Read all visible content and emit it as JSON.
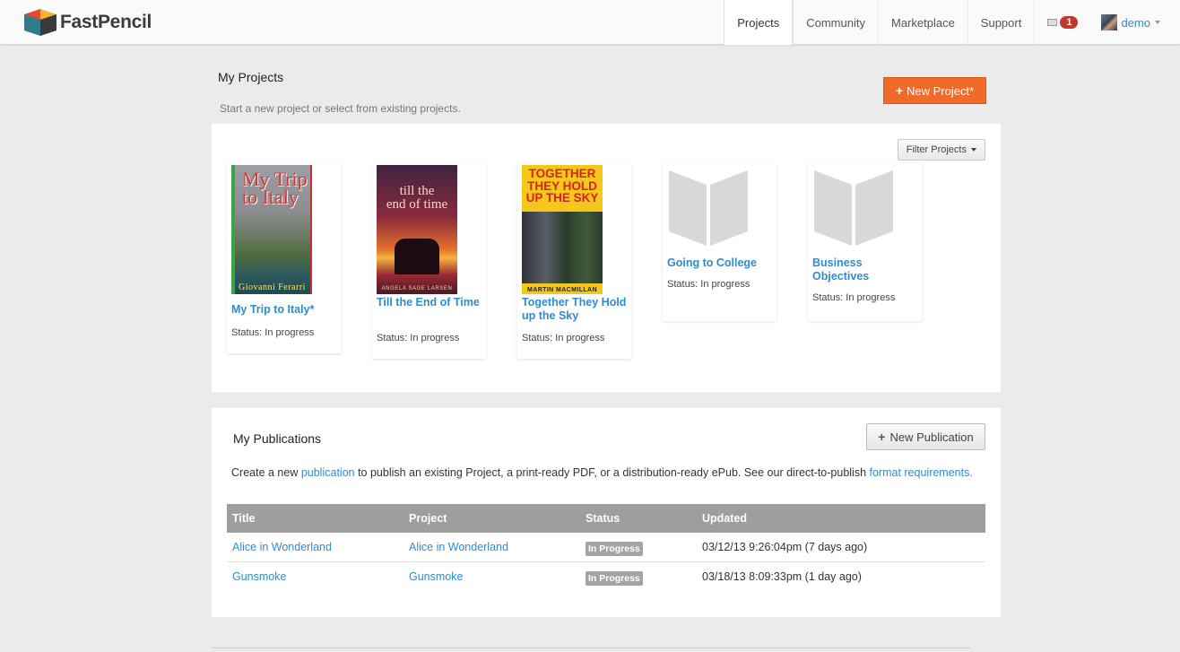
{
  "brand": {
    "name": "FastPencil",
    "logo_icon": "fastpencil-logo-icon"
  },
  "nav": {
    "items": [
      {
        "label": "Projects",
        "active": true
      },
      {
        "label": "Community",
        "active": false
      },
      {
        "label": "Marketplace",
        "active": false
      },
      {
        "label": "Support",
        "active": false
      }
    ],
    "mail_count": "1",
    "user_name": "demo"
  },
  "projects": {
    "title": "My Projects",
    "subtitle": "Start a new project or select from existing projects.",
    "new_project_label": "New Project*",
    "filter_label": "Filter Projects",
    "cards": [
      {
        "title": "My Trip to Italy*",
        "status": "Status: In progress",
        "cover": {
          "line1": "My Trip",
          "line2": "to Italy",
          "author": "Giovanni Ferarri"
        }
      },
      {
        "title": "Till the End of Time",
        "status": "Status: In progress",
        "cover": {
          "line1": "till the",
          "line2": "end of time",
          "author": "ANGELA SAGE LARSEN"
        }
      },
      {
        "title": "Together They Hold up the Sky",
        "status": "Status: In progress",
        "cover": {
          "line1": "TOGETHER",
          "line2": "THEY HOLD",
          "line3": "UP THE SKY",
          "author": "MARTIN MACMILLAN"
        }
      },
      {
        "title": "Going to College",
        "status": "Status: In progress",
        "cover": {
          "icon": "book-placeholder-icon"
        }
      },
      {
        "title": "Business Objectives",
        "status": "Status: In progress",
        "cover": {
          "icon": "book-placeholder-icon"
        }
      }
    ]
  },
  "publications": {
    "title": "My Publications",
    "new_pub_label": "New Publication",
    "desc_pre": "Create a new ",
    "desc_link1": "publication",
    "desc_mid": " to publish an existing Project, a print-ready PDF, or a distribution-ready ePub. See our direct-to-publish ",
    "desc_link2": "format requirements.",
    "columns": [
      "Title",
      "Project",
      "Status",
      "Updated"
    ],
    "rows": [
      {
        "title": "Alice in Wonderland",
        "project": "Alice in Wonderland",
        "status": "In Progress",
        "updated": "03/12/13 9:26:04pm (7 days ago)"
      },
      {
        "title": "Gunsmoke",
        "project": "Gunsmoke",
        "status": "In Progress",
        "updated": "03/18/13 8:09:33pm (1 day ago)"
      }
    ]
  },
  "colors": {
    "accent": "#f06a2a",
    "link": "#2f8ccc",
    "header_bg": "#9e9e9e",
    "badge": "#c0392b"
  }
}
